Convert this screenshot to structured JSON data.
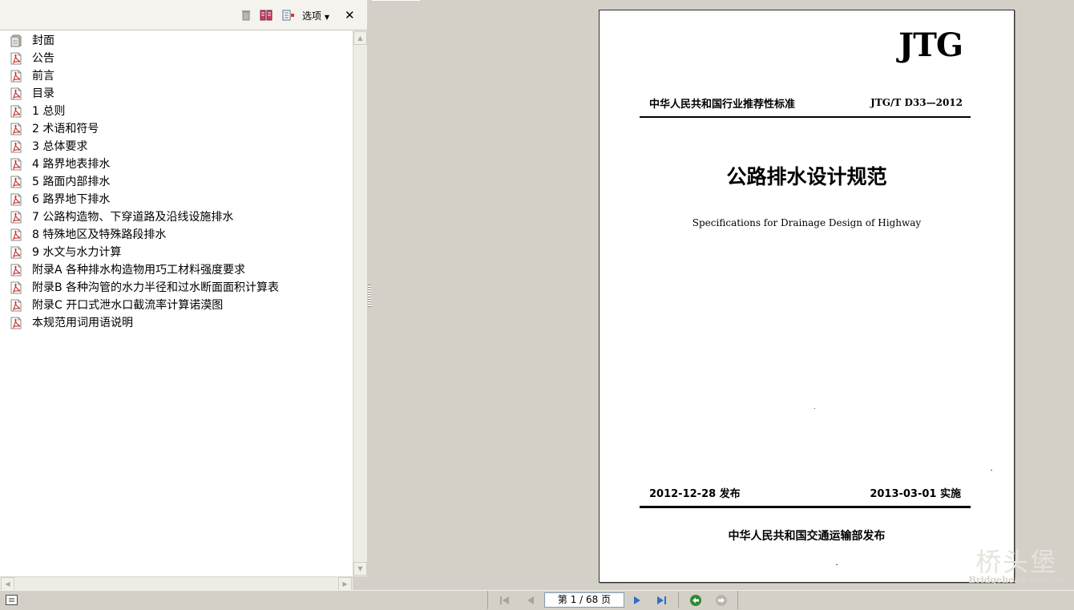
{
  "toolbar": {
    "options_label": "选项",
    "close_label": "✕"
  },
  "bookmarks": [
    {
      "label": "封面",
      "icon": "page-icon"
    },
    {
      "label": "公告",
      "icon": "pdf-icon"
    },
    {
      "label": "前言",
      "icon": "pdf-icon"
    },
    {
      "label": "目录",
      "icon": "pdf-icon"
    },
    {
      "label": "1 总则",
      "icon": "pdf-icon"
    },
    {
      "label": "2 术语和符号",
      "icon": "pdf-icon"
    },
    {
      "label": "3 总体要求",
      "icon": "pdf-icon"
    },
    {
      "label": "4 路界地表排水",
      "icon": "pdf-icon"
    },
    {
      "label": "5 路面内部排水",
      "icon": "pdf-icon"
    },
    {
      "label": "6 路界地下排水",
      "icon": "pdf-icon"
    },
    {
      "label": "7 公路构造物、下穿道路及沿线设施排水",
      "icon": "pdf-icon"
    },
    {
      "label": "8 特殊地区及特殊路段排水",
      "icon": "pdf-icon"
    },
    {
      "label": "9 水文与水力计算",
      "icon": "pdf-icon"
    },
    {
      "label": "附录A 各种排水构造物用巧工材料强度要求",
      "icon": "pdf-icon"
    },
    {
      "label": "附录B 各种沟管的水力半径和过水断面面积计算表",
      "icon": "pdf-icon"
    },
    {
      "label": "附录C 开口式泄水口截流率计算诺漠图",
      "icon": "pdf-icon"
    },
    {
      "label": "本规范用词用语说明",
      "icon": "pdf-icon"
    }
  ],
  "page": {
    "logo": "JTG",
    "category": "中华人民共和国行业推荐性标准",
    "code": "JTG/T D33—2012",
    "title": "公路排水设计规范",
    "subtitle": "Specifications for Drainage Design of Highway",
    "release": "2012-12-28 发布",
    "effective": "2013-03-01 实施",
    "publisher": "中华人民共和国交通运输部发布"
  },
  "navigation": {
    "page_display": "第 1 / 68 页",
    "current_page": 1,
    "total_pages": 68
  },
  "watermark": {
    "text": "桥头堡",
    "url": "Bridgehead.com.cn"
  },
  "colors": {
    "chrome": "#d4d0c8",
    "nav_green": "#2e8b2e",
    "nav_blue": "#2f6fc6",
    "pdf_red": "#cc2a2a"
  }
}
